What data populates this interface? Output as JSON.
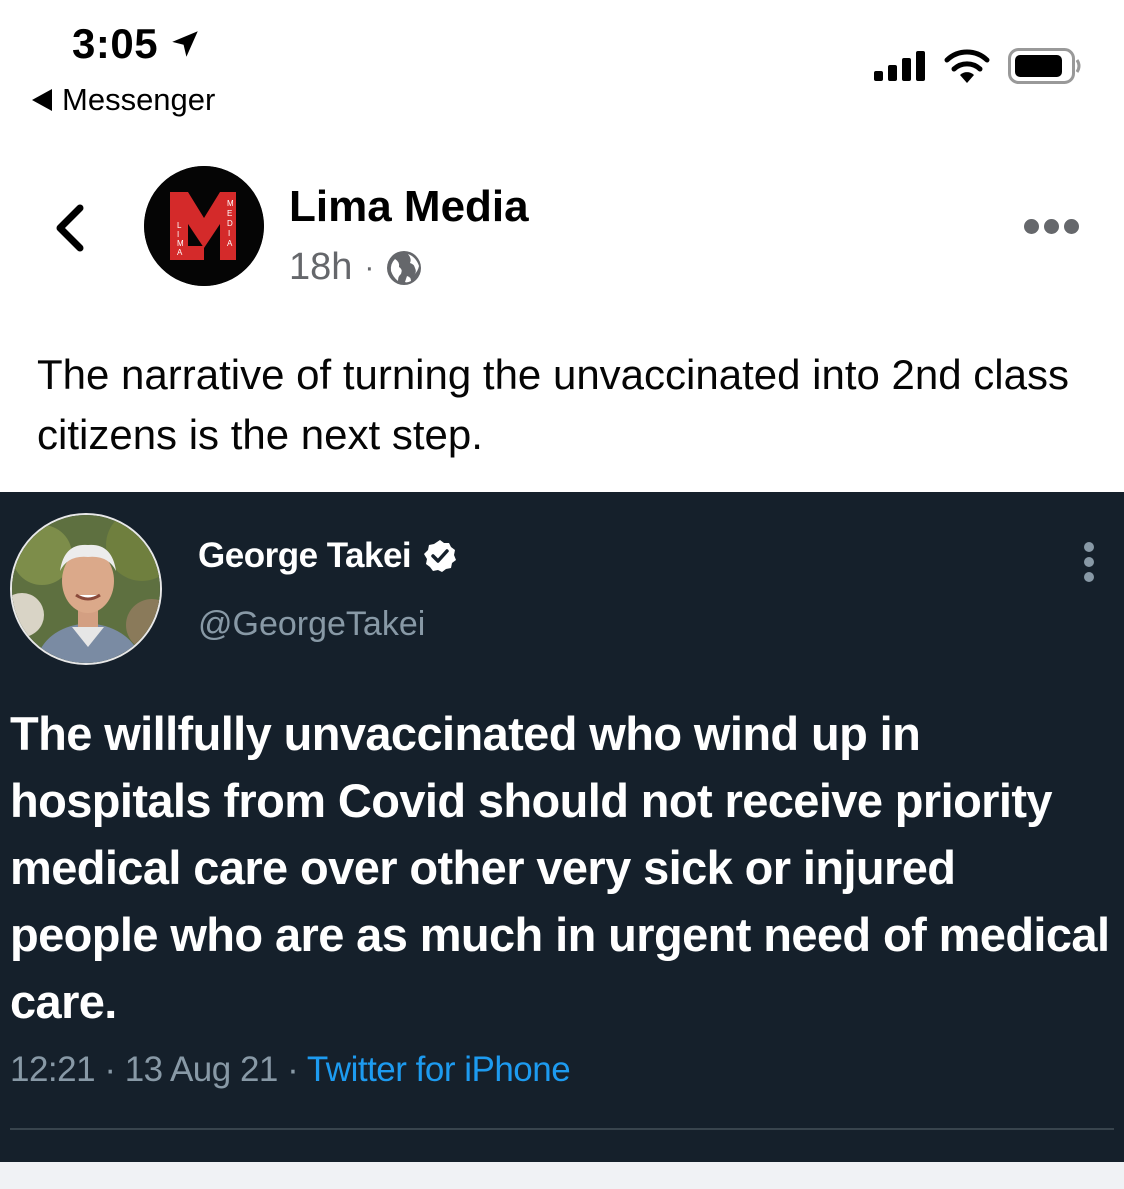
{
  "status_bar": {
    "time": "3:05",
    "back_app_label": "Messenger",
    "icons": [
      "location-arrow-icon",
      "cellular-signal-icon",
      "wifi-icon",
      "battery-icon"
    ]
  },
  "post": {
    "author": "Lima Media",
    "avatar_letters": "LIMA MEDIA",
    "time": "18h",
    "separator": "·",
    "audience_icon": "globe-icon",
    "text": "The narrative of turning the unvaccinated into 2nd class citizens is the next step."
  },
  "tweet": {
    "name": "George Takei",
    "handle": "@GeorgeTakei",
    "text": "The willfully unvaccinated who wind up in hospitals from Covid should not receive priority medical care over other very sick or injured people who are as much in urgent need of medical care.",
    "time": "12:21",
    "date": "13 Aug 21",
    "sep": "·",
    "source": "Twitter for iPhone"
  },
  "colors": {
    "tweet_bg": "#15202b",
    "tweet_secondary": "#8899a6",
    "tweet_link": "#1d9bf0",
    "meta_gray": "#65676b",
    "logo_red": "#d42a2a"
  }
}
